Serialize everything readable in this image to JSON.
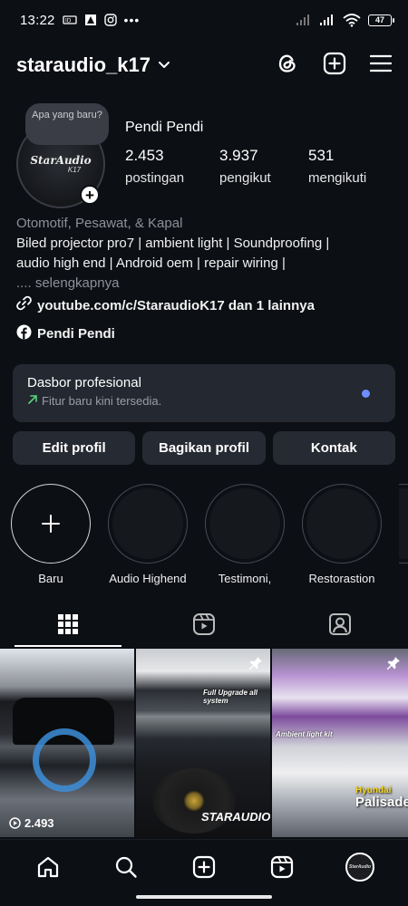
{
  "status_bar": {
    "time": "13:22",
    "battery": "47"
  },
  "header": {
    "username": "staraudio_k17"
  },
  "profile": {
    "note": "Apa yang baru?",
    "avatar_logo": "StarAudio",
    "avatar_logo_sub": "K17",
    "display_name": "Pendi Pendi",
    "stats": {
      "posts_value": "2.453",
      "posts_label": "postingan",
      "followers_value": "3.937",
      "followers_label": "pengikut",
      "following_value": "531",
      "following_label": "mengikuti"
    }
  },
  "bio": {
    "category": "Otomotif, Pesawat, & Kapal",
    "line1": "Biled projector pro7 | ambient light | Soundproofing |",
    "line2": "audio high end | Android oem | repair wiring |",
    "more": ".... selengkapnya",
    "link": "youtube.com/c/StaraudioK17 dan 1 lainnya",
    "facebook": "Pendi Pendi"
  },
  "dashboard": {
    "title": "Dasbor profesional",
    "subtitle": "Fitur baru kini tersedia."
  },
  "buttons": {
    "edit": "Edit profil",
    "share": "Bagikan profil",
    "contact": "Kontak"
  },
  "highlights": [
    {
      "label": "Baru"
    },
    {
      "label": "Audio Highend"
    },
    {
      "label": "Testimoni,"
    },
    {
      "label": "Restorastion"
    }
  ],
  "grid": {
    "reel_views": "2.493",
    "caption_b": "Full Upgrade all system",
    "caption_c": "Ambient light kit",
    "brand_b": "STARAUDIO",
    "hyundai": "Hyundai",
    "palisade": "Palisade"
  },
  "colors": {
    "background": "#0c0f14",
    "card": "#232831",
    "button": "#262a33",
    "accent_dot": "#6d8fff",
    "trend_green": "#5bd37a"
  }
}
